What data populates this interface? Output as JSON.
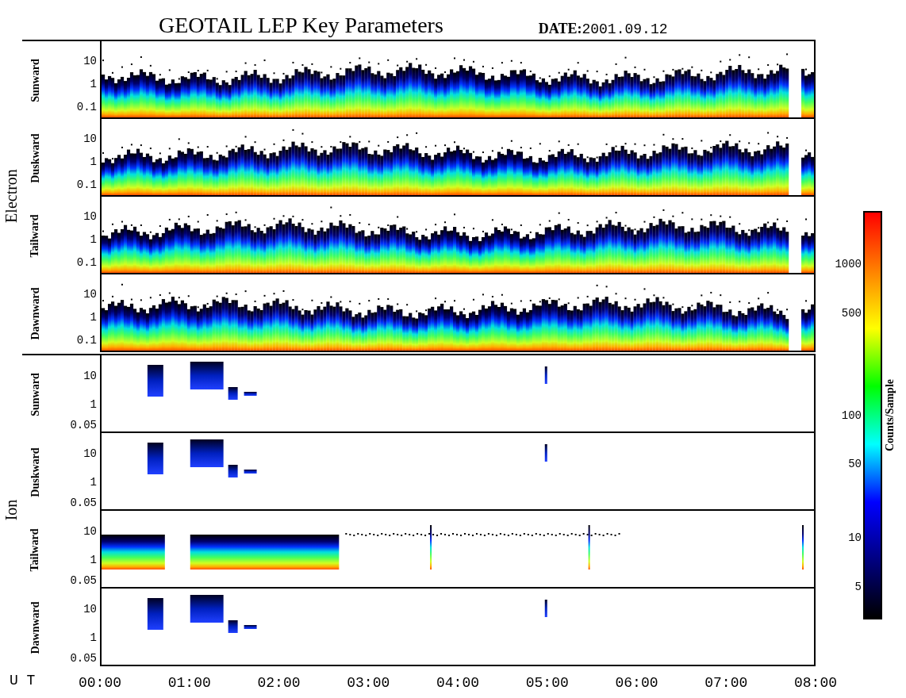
{
  "title": "GEOTAIL LEP Key Parameters",
  "date_label": "DATE:",
  "date": "2001.09.12",
  "groups": [
    {
      "label": "Electron",
      "panels": [
        {
          "label": "Sunward",
          "kind": "band",
          "yticks": [
            "10",
            "1",
            "0.1"
          ]
        },
        {
          "label": "Duskward",
          "kind": "band",
          "yticks": [
            "10",
            "1",
            "0.1"
          ]
        },
        {
          "label": "Tailward",
          "kind": "band",
          "yticks": [
            "10",
            "1",
            "0.1"
          ]
        },
        {
          "label": "Dawnward",
          "kind": "band",
          "yticks": [
            "10",
            "1",
            "0.1"
          ]
        }
      ]
    },
    {
      "label": "Ion",
      "panels": [
        {
          "label": "Sunward",
          "kind": "patchy",
          "yticks": [
            "10",
            "1",
            "0.05"
          ]
        },
        {
          "label": "Duskward",
          "kind": "patchy",
          "yticks": [
            "10",
            "1",
            "0.05"
          ]
        },
        {
          "label": "Tailward",
          "kind": "partial",
          "yticks": [
            "10",
            "1",
            "0.05"
          ]
        },
        {
          "label": "Dawnward",
          "kind": "patchy",
          "yticks": [
            "10",
            "1",
            "0.05"
          ]
        }
      ]
    }
  ],
  "x_axis": {
    "label": "U T",
    "ticks": [
      "00:00",
      "01:00",
      "02:00",
      "03:00",
      "04:00",
      "05:00",
      "06:00",
      "07:00",
      "08:00"
    ]
  },
  "colorbar": {
    "label": "Counts/Sample",
    "ticks": [
      "1000",
      "500",
      "100",
      "50",
      "10",
      "5"
    ]
  }
}
